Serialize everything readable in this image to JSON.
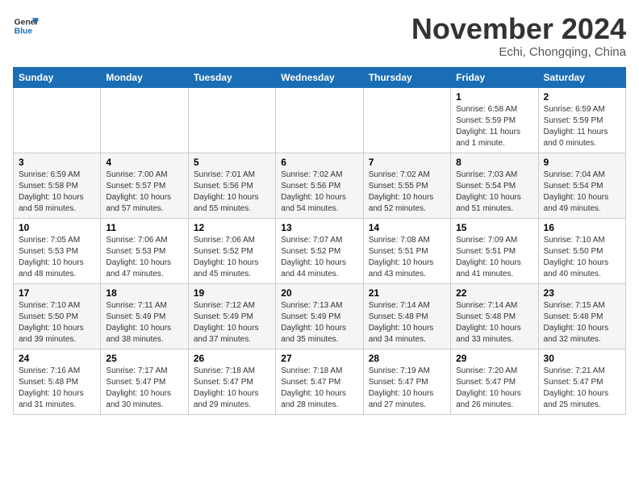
{
  "header": {
    "logo_line1": "General",
    "logo_line2": "Blue",
    "month_title": "November 2024",
    "location": "Echi, Chongqing, China"
  },
  "days_of_week": [
    "Sunday",
    "Monday",
    "Tuesday",
    "Wednesday",
    "Thursday",
    "Friday",
    "Saturday"
  ],
  "weeks": [
    [
      {
        "day": "",
        "info": ""
      },
      {
        "day": "",
        "info": ""
      },
      {
        "day": "",
        "info": ""
      },
      {
        "day": "",
        "info": ""
      },
      {
        "day": "",
        "info": ""
      },
      {
        "day": "1",
        "info": "Sunrise: 6:58 AM\nSunset: 5:59 PM\nDaylight: 11 hours\nand 1 minute."
      },
      {
        "day": "2",
        "info": "Sunrise: 6:59 AM\nSunset: 5:59 PM\nDaylight: 11 hours\nand 0 minutes."
      }
    ],
    [
      {
        "day": "3",
        "info": "Sunrise: 6:59 AM\nSunset: 5:58 PM\nDaylight: 10 hours\nand 58 minutes."
      },
      {
        "day": "4",
        "info": "Sunrise: 7:00 AM\nSunset: 5:57 PM\nDaylight: 10 hours\nand 57 minutes."
      },
      {
        "day": "5",
        "info": "Sunrise: 7:01 AM\nSunset: 5:56 PM\nDaylight: 10 hours\nand 55 minutes."
      },
      {
        "day": "6",
        "info": "Sunrise: 7:02 AM\nSunset: 5:56 PM\nDaylight: 10 hours\nand 54 minutes."
      },
      {
        "day": "7",
        "info": "Sunrise: 7:02 AM\nSunset: 5:55 PM\nDaylight: 10 hours\nand 52 minutes."
      },
      {
        "day": "8",
        "info": "Sunrise: 7:03 AM\nSunset: 5:54 PM\nDaylight: 10 hours\nand 51 minutes."
      },
      {
        "day": "9",
        "info": "Sunrise: 7:04 AM\nSunset: 5:54 PM\nDaylight: 10 hours\nand 49 minutes."
      }
    ],
    [
      {
        "day": "10",
        "info": "Sunrise: 7:05 AM\nSunset: 5:53 PM\nDaylight: 10 hours\nand 48 minutes."
      },
      {
        "day": "11",
        "info": "Sunrise: 7:06 AM\nSunset: 5:53 PM\nDaylight: 10 hours\nand 47 minutes."
      },
      {
        "day": "12",
        "info": "Sunrise: 7:06 AM\nSunset: 5:52 PM\nDaylight: 10 hours\nand 45 minutes."
      },
      {
        "day": "13",
        "info": "Sunrise: 7:07 AM\nSunset: 5:52 PM\nDaylight: 10 hours\nand 44 minutes."
      },
      {
        "day": "14",
        "info": "Sunrise: 7:08 AM\nSunset: 5:51 PM\nDaylight: 10 hours\nand 43 minutes."
      },
      {
        "day": "15",
        "info": "Sunrise: 7:09 AM\nSunset: 5:51 PM\nDaylight: 10 hours\nand 41 minutes."
      },
      {
        "day": "16",
        "info": "Sunrise: 7:10 AM\nSunset: 5:50 PM\nDaylight: 10 hours\nand 40 minutes."
      }
    ],
    [
      {
        "day": "17",
        "info": "Sunrise: 7:10 AM\nSunset: 5:50 PM\nDaylight: 10 hours\nand 39 minutes."
      },
      {
        "day": "18",
        "info": "Sunrise: 7:11 AM\nSunset: 5:49 PM\nDaylight: 10 hours\nand 38 minutes."
      },
      {
        "day": "19",
        "info": "Sunrise: 7:12 AM\nSunset: 5:49 PM\nDaylight: 10 hours\nand 37 minutes."
      },
      {
        "day": "20",
        "info": "Sunrise: 7:13 AM\nSunset: 5:49 PM\nDaylight: 10 hours\nand 35 minutes."
      },
      {
        "day": "21",
        "info": "Sunrise: 7:14 AM\nSunset: 5:48 PM\nDaylight: 10 hours\nand 34 minutes."
      },
      {
        "day": "22",
        "info": "Sunrise: 7:14 AM\nSunset: 5:48 PM\nDaylight: 10 hours\nand 33 minutes."
      },
      {
        "day": "23",
        "info": "Sunrise: 7:15 AM\nSunset: 5:48 PM\nDaylight: 10 hours\nand 32 minutes."
      }
    ],
    [
      {
        "day": "24",
        "info": "Sunrise: 7:16 AM\nSunset: 5:48 PM\nDaylight: 10 hours\nand 31 minutes."
      },
      {
        "day": "25",
        "info": "Sunrise: 7:17 AM\nSunset: 5:47 PM\nDaylight: 10 hours\nand 30 minutes."
      },
      {
        "day": "26",
        "info": "Sunrise: 7:18 AM\nSunset: 5:47 PM\nDaylight: 10 hours\nand 29 minutes."
      },
      {
        "day": "27",
        "info": "Sunrise: 7:18 AM\nSunset: 5:47 PM\nDaylight: 10 hours\nand 28 minutes."
      },
      {
        "day": "28",
        "info": "Sunrise: 7:19 AM\nSunset: 5:47 PM\nDaylight: 10 hours\nand 27 minutes."
      },
      {
        "day": "29",
        "info": "Sunrise: 7:20 AM\nSunset: 5:47 PM\nDaylight: 10 hours\nand 26 minutes."
      },
      {
        "day": "30",
        "info": "Sunrise: 7:21 AM\nSunset: 5:47 PM\nDaylight: 10 hours\nand 25 minutes."
      }
    ]
  ]
}
